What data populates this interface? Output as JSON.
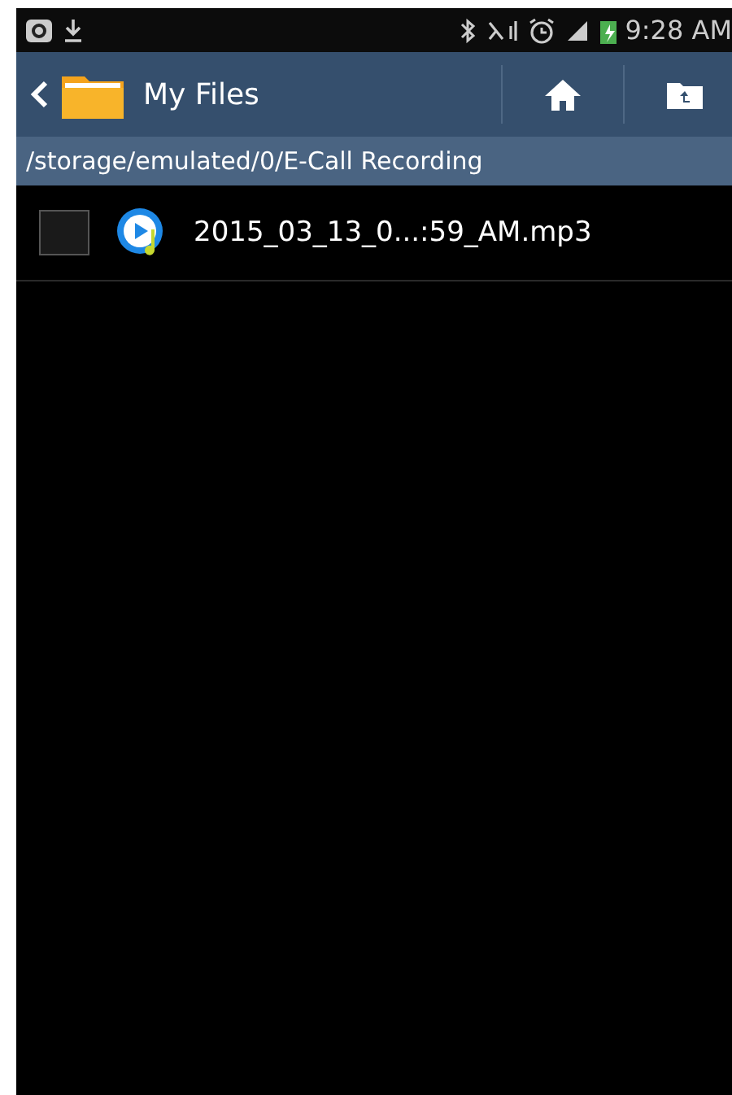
{
  "status_bar": {
    "time": "9:28 AM"
  },
  "action_bar": {
    "title": "My Files"
  },
  "path": "/storage/emulated/0/E-Call Recording",
  "files": [
    {
      "name": "2015_03_13_0...:59_AM.mp3",
      "checked": false
    }
  ]
}
